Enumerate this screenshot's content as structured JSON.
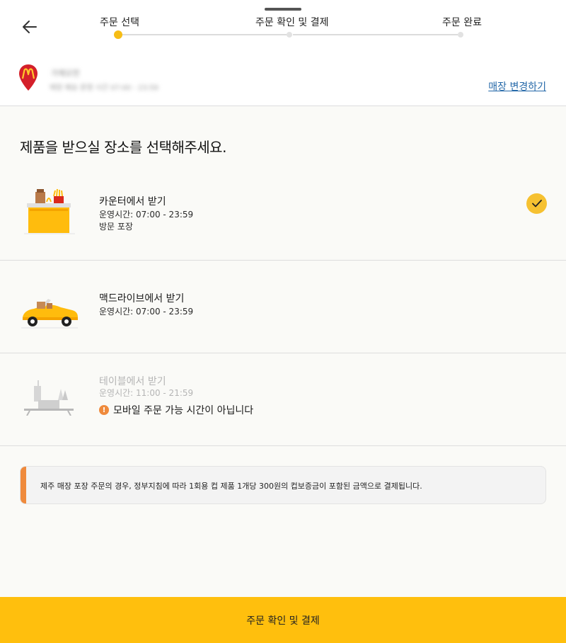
{
  "steps": [
    {
      "label": "주문 선택",
      "state": "active"
    },
    {
      "label": "주문 확인 및 결제",
      "state": "pending"
    },
    {
      "label": "주문 완료",
      "state": "pending"
    }
  ],
  "store": {
    "name": "가제오먼",
    "info": "매장 배송 운영 시간 07:00 - 23:59",
    "change_label": "매장 변경하기"
  },
  "main": {
    "title": "제품을 받으실 장소를 선택해주세요."
  },
  "options": [
    {
      "title": "카운터에서 받기",
      "hours": "운영시간: 07:00 - 23:59",
      "extra": "방문 포장",
      "selected": true,
      "disabled": false
    },
    {
      "title": "맥드라이브에서 받기",
      "hours": "운영시간: 07:00 - 23:59",
      "selected": false,
      "disabled": false
    },
    {
      "title": "테이블에서 받기",
      "hours": "운영시간: 11:00 - 21:59",
      "warning": "모바일 주문 가능 시간이 아닙니다",
      "selected": false,
      "disabled": true
    }
  ],
  "notice": {
    "text": "제주 매장 포장 주문의 경우, 정부지침에 따라 1회용 컵 제품 1개당 300원의 컵보증금이 포함된 금액으로 결제됩니다."
  },
  "cta": {
    "label": "주문 확인 및 결제"
  },
  "colors": {
    "accent": "#ffbf0d",
    "check": "#f6c131",
    "warning": "#ef8a3c",
    "link": "#2468a8"
  },
  "icons": [
    "back-arrow-icon",
    "mcdonalds-pin-icon",
    "check-icon",
    "warning-icon"
  ]
}
